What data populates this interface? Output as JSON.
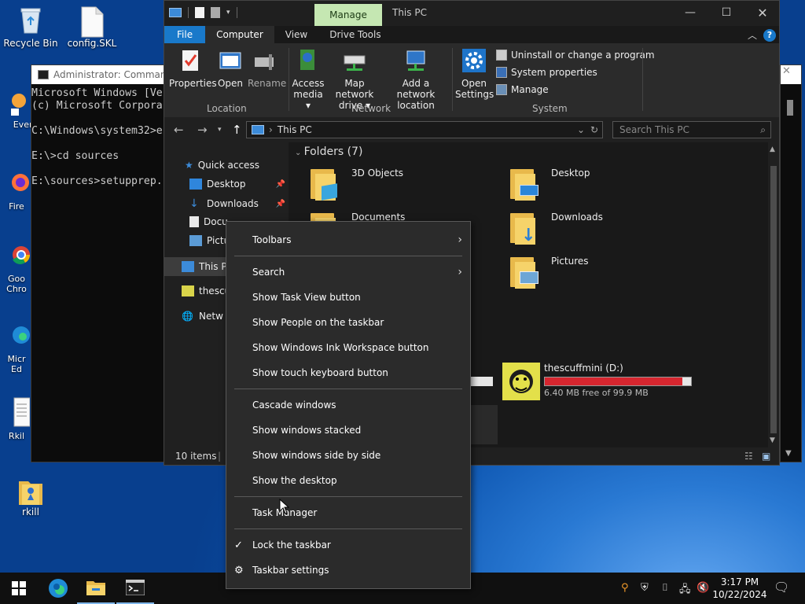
{
  "desktop": {
    "icons": [
      {
        "label": "Recycle Bin",
        "icon": "recycle-bin-icon"
      },
      {
        "label": "config.SKL",
        "icon": "file-icon"
      },
      {
        "label": "Every",
        "icon": "everything-icon"
      },
      {
        "label": "Fire",
        "icon": "firefox-icon"
      },
      {
        "label": "Goo",
        "label2": "Chro",
        "icon": "chrome-icon"
      },
      {
        "label": "Micr",
        "label2": "Ed",
        "icon": "edge-icon"
      },
      {
        "label": "Rkil",
        "icon": "text-file-icon"
      },
      {
        "label": "rkill",
        "icon": "rkill-icon"
      }
    ]
  },
  "console": {
    "title": "Administrator: Command",
    "lines": [
      "Microsoft Windows [Ve",
      "(c) Microsoft Corpora",
      "",
      "C:\\Windows\\system32>e",
      "",
      "E:\\>cd sources",
      "",
      "E:\\sources>setupprep."
    ]
  },
  "explorer": {
    "context_tab": "Manage",
    "title": "This PC",
    "tabs": [
      "File",
      "Computer",
      "View",
      "Drive Tools"
    ],
    "active_tab": "Computer",
    "ribbon": {
      "location": {
        "group": "Location",
        "buttons": [
          "Properties",
          "Open",
          "Rename"
        ]
      },
      "network": {
        "group": "Network",
        "buttons": [
          {
            "line1": "Access",
            "line2": "media ▾"
          },
          {
            "line1": "Map network",
            "line2": "drive ▾"
          },
          {
            "line1": "Add a network",
            "line2": "location"
          }
        ]
      },
      "system": {
        "group": "System",
        "open_settings": {
          "line1": "Open",
          "line2": "Settings"
        },
        "items": [
          "Uninstall or change a program",
          "System properties",
          "Manage"
        ]
      }
    },
    "address": {
      "path": "This PC",
      "search_placeholder": "Search This PC"
    },
    "nav": {
      "quick_access": "Quick access",
      "items": [
        "Desktop",
        "Downloads",
        "Docu",
        "Pictu"
      ],
      "this_pc": "This P",
      "thescu": "thescu",
      "network": "Netw"
    },
    "folders_header": "Folders (7)",
    "folders": [
      {
        "name": "3D Objects"
      },
      {
        "name": "Desktop"
      },
      {
        "name": "Documents"
      },
      {
        "name": "Downloads"
      },
      {
        "name": "Pictures"
      }
    ],
    "drive": {
      "name": "thescuffmini (D:)",
      "free": "6.40 MB free of 99.9 MB",
      "used_fraction": 0.94
    },
    "status": "10 items"
  },
  "context_menu": {
    "items": [
      {
        "label": "Toolbars",
        "submenu": true
      },
      {
        "label": "Search",
        "submenu": true
      },
      {
        "label": "Show Task View button"
      },
      {
        "label": "Show People on the taskbar"
      },
      {
        "label": "Show Windows Ink Workspace button"
      },
      {
        "label": "Show touch keyboard button"
      },
      {
        "label": "Cascade windows"
      },
      {
        "label": "Show windows stacked"
      },
      {
        "label": "Show windows side by side"
      },
      {
        "label": "Show the desktop"
      },
      {
        "label": "Task Manager"
      },
      {
        "label": "Lock the taskbar",
        "checked": true
      },
      {
        "label": "Taskbar settings",
        "icon": "gear-icon"
      }
    ]
  },
  "taskbar": {
    "pinned": [
      "start-button",
      "edge-icon",
      "file-explorer-icon",
      "command-prompt-icon"
    ],
    "time": "3:17 PM",
    "date": "10/22/2024"
  },
  "colors": {
    "accent": "#1979ca",
    "drive_bar_full": "#d6262f",
    "manage_tab": "#c5e7b2"
  }
}
